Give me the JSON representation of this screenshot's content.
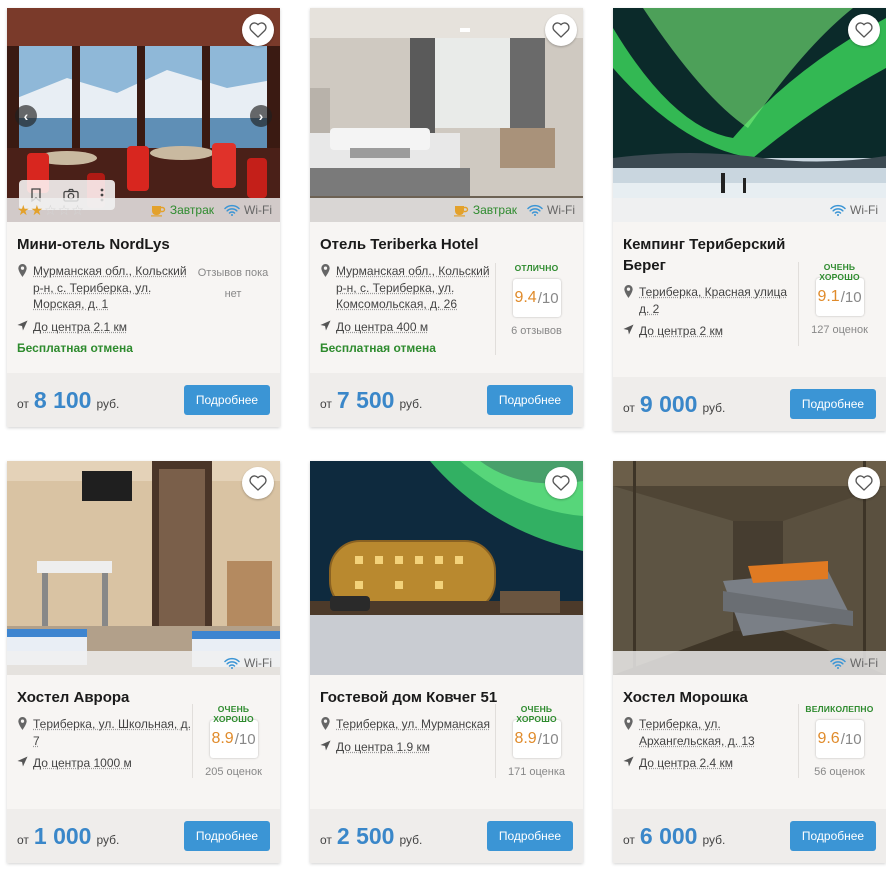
{
  "common": {
    "wifi_label": "Wi-Fi",
    "breakfast_label": "Завтрак",
    "details_button": "Подробнее",
    "price_from": "от",
    "currency": "руб."
  },
  "cards": [
    {
      "title": "Мини-отель NordLys",
      "address": "Мурманская обл., Кольский р-н, с. Териберка, ул. Морская, д. 1",
      "distance": "До центра 2.1 км",
      "cancellation": "Бесплатная отмена",
      "no_reviews": "Отзывов пока нет",
      "price": "8 100",
      "stars": 2,
      "stars_max": 5,
      "breakfast": true
    },
    {
      "title": "Отель Teriberka Hotel",
      "address": "Мурманская обл., Кольский р-н, с. Териберка, ул. Комсомольская, д. 26",
      "distance": "До центра 400 м",
      "cancellation": "Бесплатная отмена",
      "grade": "отлично",
      "score": "9.4",
      "score_den": "/10",
      "reviews": "6 отзывов",
      "price": "7 500",
      "breakfast": true
    },
    {
      "title": "Кемпинг Териберский Берег",
      "address": "Териберка, Красная улица д. 2",
      "distance": "До центра 2 км",
      "grade": "очень хорошо",
      "score": "9.1",
      "score_den": "/10",
      "reviews": "127 оценок",
      "price": "9 000"
    },
    {
      "title": "Хостел Аврора",
      "address": "Териберка, ул. Школьная, д. 7",
      "distance": "До центра 1000 м",
      "grade": "очень хорошо",
      "score": "8.9",
      "score_den": "/10",
      "reviews": "205 оценок",
      "price": "1 000"
    },
    {
      "title": "Гостевой дом Ковчег 51",
      "address": "Териберка, ул. Мурманская",
      "distance": "До центра 1.9 км",
      "grade": "очень хорошо",
      "score": "8.9",
      "score_den": "/10",
      "reviews": "171 оценка",
      "price": "2 500"
    },
    {
      "title": "Хостел Морошка",
      "address": "Териберка, ул. Архангельская, д. 13",
      "distance": "До центра 2.4 км",
      "grade": "великолепно",
      "score": "9.6",
      "score_den": "/10",
      "reviews": "56 оценок",
      "price": "6 000"
    }
  ],
  "colors": {
    "accent_blue": "#3b95d5",
    "price_blue": "#3a87c9",
    "green": "#2e8b2e",
    "score_orange": "#e08b2b",
    "star_gold": "#e3a12b"
  }
}
